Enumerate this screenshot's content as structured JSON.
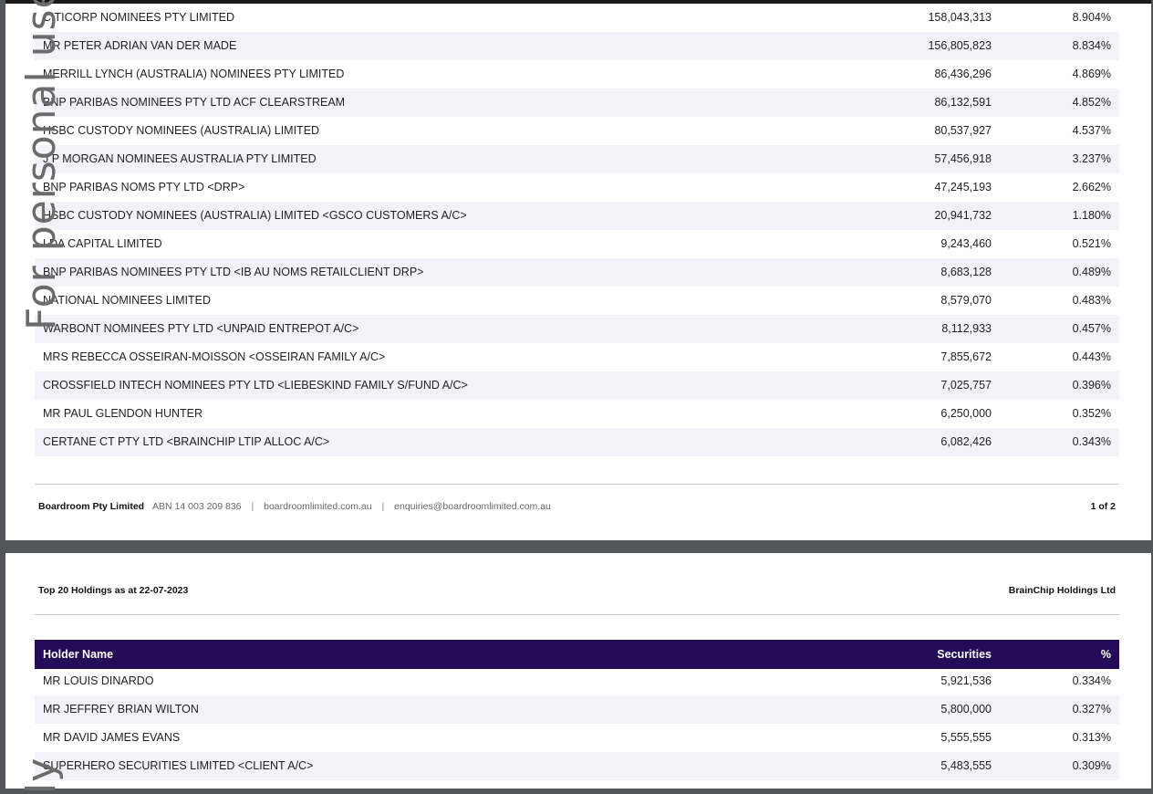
{
  "page1": {
    "rows": [
      {
        "name": "CITICORP NOMINEES PTY LIMITED",
        "securities": "158,043,313",
        "pct": "8.904%"
      },
      {
        "name": "MR PETER ADRIAN VAN DER MADE",
        "securities": "156,805,823",
        "pct": "8.834%"
      },
      {
        "name": "MERRILL LYNCH (AUSTRALIA) NOMINEES PTY LIMITED",
        "securities": "86,436,296",
        "pct": "4.869%"
      },
      {
        "name": "BNP PARIBAS NOMINEES PTY LTD ACF CLEARSTREAM",
        "securities": "86,132,591",
        "pct": "4.852%"
      },
      {
        "name": "HSBC CUSTODY NOMINEES (AUSTRALIA) LIMITED",
        "securities": "80,537,927",
        "pct": "4.537%"
      },
      {
        "name": "J P MORGAN NOMINEES AUSTRALIA PTY LIMITED",
        "securities": "57,456,918",
        "pct": "3.237%"
      },
      {
        "name": "BNP PARIBAS NOMS PTY LTD <DRP>",
        "securities": "47,245,193",
        "pct": "2.662%"
      },
      {
        "name": "HSBC CUSTODY NOMINEES (AUSTRALIA) LIMITED <GSCO CUSTOMERS A/C>",
        "securities": "20,941,732",
        "pct": "1.180%"
      },
      {
        "name": "LDA CAPITAL LIMITED",
        "securities": "9,243,460",
        "pct": "0.521%"
      },
      {
        "name": "BNP PARIBAS NOMINEES PTY LTD <IB AU NOMS RETAILCLIENT DRP>",
        "securities": "8,683,128",
        "pct": "0.489%"
      },
      {
        "name": "NATIONAL NOMINEES LIMITED",
        "securities": "8,579,070",
        "pct": "0.483%"
      },
      {
        "name": "WARBONT NOMINEES PTY LTD <UNPAID ENTREPOT A/C>",
        "securities": "8,112,933",
        "pct": "0.457%"
      },
      {
        "name": "MRS REBECCA OSSEIRAN-MOISSON <OSSEIRAN FAMILY A/C>",
        "securities": "7,855,672",
        "pct": "0.443%"
      },
      {
        "name": "CROSSFIELD INTECH NOMINEES PTY LTD <LIEBESKIND FAMILY S/FUND A/C>",
        "securities": "7,025,757",
        "pct": "0.396%"
      },
      {
        "name": "MR PAUL GLENDON HUNTER",
        "securities": "6,250,000",
        "pct": "0.352%"
      },
      {
        "name": "CERTANE CT PTY LTD <BRAINCHIP LTIP ALLOC A/C>",
        "securities": "6,082,426",
        "pct": "0.343%"
      }
    ],
    "footer": {
      "brand": "Boardroom Pty Limited",
      "abn": "ABN 14 003 209 836",
      "sep": "|",
      "website": "boardroomlimited.com.au",
      "email": "enquiries@boardroomlimited.com.au",
      "page": "1 of 2"
    }
  },
  "page2": {
    "header_left": "Top 20 Holdings as at 22-07-2023",
    "header_right": "BrainChip Holdings Ltd",
    "columns": {
      "name": "Holder Name",
      "securities": "Securities",
      "pct": "%"
    },
    "rows": [
      {
        "name": "MR LOUIS DINARDO",
        "securities": "5,921,536",
        "pct": "0.334%"
      },
      {
        "name": "MR JEFFREY BRIAN WILTON",
        "securities": "5,800,000",
        "pct": "0.327%"
      },
      {
        "name": "MR DAVID JAMES EVANS",
        "securities": "5,555,555",
        "pct": "0.313%"
      },
      {
        "name": "SUPERHERO SECURITIES LIMITED <CLIENT A/C>",
        "securities": "5,483,555",
        "pct": "0.309%"
      }
    ]
  },
  "watermark": {
    "page1_text": "For personal use o",
    "page2_text": "ly"
  }
}
